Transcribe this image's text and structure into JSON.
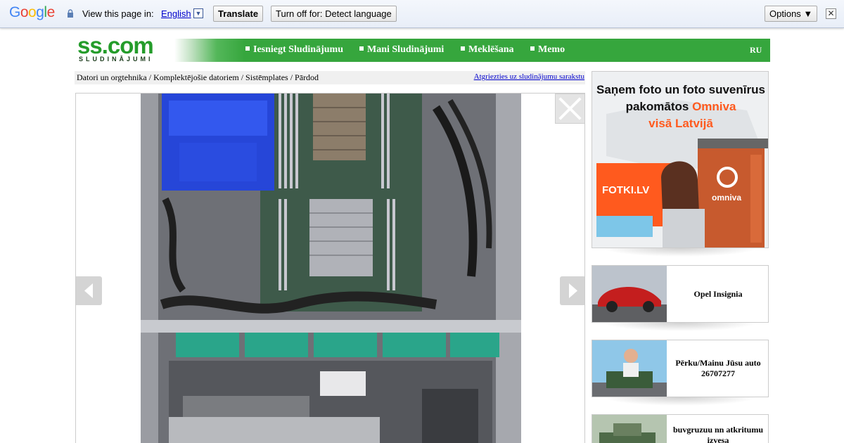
{
  "translate_bar": {
    "logo": [
      "G",
      "o",
      "o",
      "g",
      "l",
      "e"
    ],
    "logo_colors": [
      "#4285f4",
      "#ea4335",
      "#fbbc05",
      "#4285f4",
      "#34a853",
      "#ea4335"
    ],
    "view_text": "View this page in:",
    "language": "English",
    "translate_label": "Translate",
    "turn_off_label": "Turn off for: Detect language",
    "options_label": "Options ▼",
    "close_glyph": "✕"
  },
  "site": {
    "logo_main": "ss.com",
    "logo_sub": "SLUDINĀJUMI",
    "brand_color": "#36a63d",
    "nav": [
      "Iesniegt Sludinājumu",
      "Mani Sludinājumi",
      "Meklēšana",
      "Memo"
    ],
    "lang_switch": "RU"
  },
  "breadcrumb": {
    "path": "Datori un orgtehnika / Komplektējošie datoriem / Sistēmplates / Pārdod",
    "back_link": "Atgriezties uz sludinājumu sarakstu"
  },
  "banner": {
    "line1": "Saņem foto un foto suvenīrus",
    "line2_a": "pakomātos ",
    "line2_b": "Omniva",
    "line3": "visā Latvijā",
    "brand_left": "FOTKI.LV",
    "brand_right": "omniva"
  },
  "side_ads": [
    {
      "label": "Opel Insignia"
    },
    {
      "label": "Pērku/Mainu Jūsu auto 26707277"
    },
    {
      "label": "buvgruzuu nn atkritumu izvesa"
    }
  ]
}
